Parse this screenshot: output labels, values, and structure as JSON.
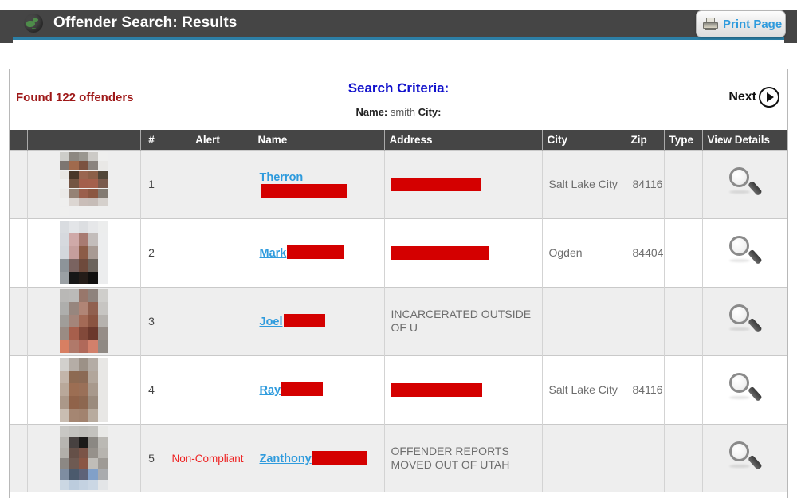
{
  "header": {
    "title": "Offender Search: Results",
    "globe_icon": "globe-icon",
    "print_button_label": "Print Page",
    "print_icon": "printer-icon",
    "accent_color": "#2c7fa6",
    "bar_color": "#454545"
  },
  "results": {
    "found_text": "Found 122 offenders",
    "found_color": "#9e1818",
    "criteria_title": "Search Criteria:",
    "criteria": {
      "name_label": "Name:",
      "name_value": "smith",
      "city_label": "City:",
      "city_value": ""
    },
    "next_label": "Next",
    "next_icon": "circle-arrow-right-icon"
  },
  "table": {
    "columns": [
      "",
      "",
      "#",
      "Alert",
      "Name",
      "Address",
      "City",
      "Zip",
      "Type",
      "View Details"
    ],
    "link_color": "#2f9bdd",
    "redaction_color": "#d40000",
    "alert_color": "#ee2222",
    "rows": [
      {
        "num": "1",
        "alert": "",
        "name_link": "Therron",
        "name_redacted_width": "108",
        "address": "",
        "address_redacted_width": "112",
        "city": "Salt Lake City",
        "zip": "84116",
        "type": "",
        "details_icon": "magnifier-icon",
        "photo": "photo-thumbnail-pixelated"
      },
      {
        "num": "2",
        "alert": "",
        "name_link": "Mark",
        "name_redacted_width": "72",
        "address": "",
        "address_redacted_width": "122",
        "city": "Ogden",
        "zip": "84404",
        "type": "",
        "details_icon": "magnifier-icon",
        "photo": "photo-thumbnail-pixelated"
      },
      {
        "num": "3",
        "alert": "",
        "name_link": "Joel",
        "name_redacted_width": "52",
        "address": "INCARCERATED OUTSIDE OF U",
        "address_redacted_width": "0",
        "city": "",
        "zip": "",
        "type": "",
        "details_icon": "magnifier-icon",
        "photo": "photo-thumbnail-pixelated"
      },
      {
        "num": "4",
        "alert": "",
        "name_link": "Ray",
        "name_redacted_width": "52",
        "address": "",
        "address_redacted_width": "114",
        "city": "Salt Lake City",
        "zip": "84116",
        "type": "",
        "details_icon": "magnifier-icon",
        "photo": "photo-thumbnail-pixelated"
      },
      {
        "num": "5",
        "alert": "Non-Compliant",
        "name_link": "Zanthony",
        "name_redacted_width": "68",
        "address": "OFFENDER REPORTS MOVED OUT OF UTAH",
        "address_redacted_width": "0",
        "city": "",
        "zip": "",
        "type": "",
        "details_icon": "magnifier-icon",
        "photo": "photo-thumbnail-pixelated"
      }
    ]
  }
}
